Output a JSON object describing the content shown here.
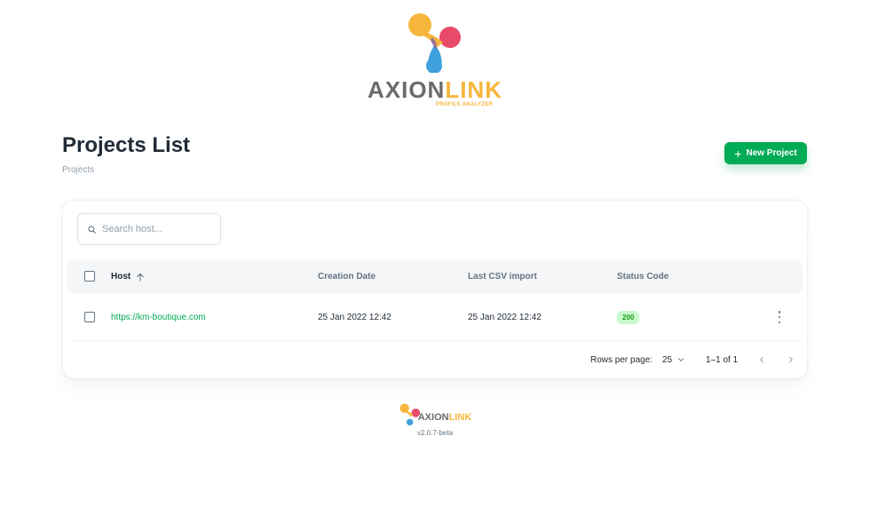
{
  "brand": {
    "name_part1": "AXION",
    "name_part2": "LINK",
    "tagline": "PROFILE ANALYZER",
    "colors": {
      "yellow": "#f6b63c",
      "pink": "#e84a6a",
      "blue": "#3ea0dc",
      "gray": "#6b6b6b"
    }
  },
  "page": {
    "title": "Projects List",
    "breadcrumb": "Projects",
    "new_button_label": "New Project",
    "accent": "#00ab55"
  },
  "search": {
    "placeholder": "Search host...",
    "value": ""
  },
  "table": {
    "columns": [
      "Host",
      "Creation Date",
      "Last CSV import",
      "Status Code"
    ],
    "sort": {
      "column": "Host",
      "direction": "asc"
    },
    "rows": [
      {
        "host": "https://km-boutique.com",
        "creation_date": "25 Jan 2022 12:42",
        "last_csv_import": "25 Jan 2022 12:42",
        "status_code": "200"
      }
    ]
  },
  "pagination": {
    "rows_per_page_label": "Rows per page:",
    "rows_per_page": "25",
    "range": "1–1 of 1"
  },
  "footer": {
    "version": "v2.0.7-beta"
  }
}
